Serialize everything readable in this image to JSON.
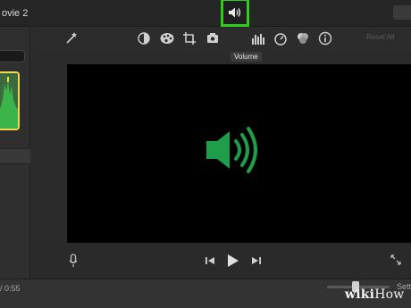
{
  "window": {
    "title": "ovie 2"
  },
  "toolbar": {
    "tools": [
      {
        "name": "magic-wand-icon"
      },
      {
        "name": "color-balance-icon"
      },
      {
        "name": "color-correction-icon"
      },
      {
        "name": "crop-icon"
      },
      {
        "name": "stabilization-icon"
      },
      {
        "name": "volume-icon"
      },
      {
        "name": "equalizer-icon"
      },
      {
        "name": "speed-icon"
      },
      {
        "name": "filter-icon"
      },
      {
        "name": "info-icon"
      }
    ],
    "reset_all_label": "Reset All",
    "tooltip": "Volume",
    "active_tool": "volume",
    "highlight_color": "#2ecc1b"
  },
  "viewer": {
    "speaker_color": "#1e9e4a",
    "background": "#000000"
  },
  "playback": {
    "mic": "microphone-icon",
    "prev": "skip-back-icon",
    "play": "play-icon",
    "next": "skip-forward-icon",
    "fullscreen": "fullscreen-icon"
  },
  "timeline": {
    "timecode": "/ 0:55",
    "settings_label": "Sett",
    "zoom_level": 0.4
  },
  "watermark": {
    "text_bold": "wiki",
    "text_rest": "How"
  }
}
